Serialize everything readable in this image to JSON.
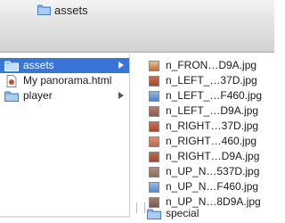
{
  "header": {
    "location_label": "assets"
  },
  "column1": {
    "items": [
      {
        "label": "assets",
        "icon": "folder-icon",
        "selected": true,
        "has_children": true
      },
      {
        "label": "My panorama.html",
        "icon": "html-file-icon",
        "selected": false,
        "has_children": false
      },
      {
        "label": "player",
        "icon": "folder-icon",
        "selected": false,
        "has_children": true
      }
    ]
  },
  "column2": {
    "items": [
      {
        "label": "n_FRON…D9A.jpg",
        "icon": "image-file-icon",
        "color": "#c46a3c"
      },
      {
        "label": "n_LEFT_…37D.jpg",
        "icon": "image-file-icon",
        "color": "#a24a2c"
      },
      {
        "label": "n_LEFT_…F460.jpg",
        "icon": "image-file-icon",
        "color": "#4a86c8"
      },
      {
        "label": "n_LEFT_…D9A.jpg",
        "icon": "image-file-icon",
        "color": "#8b5a4a"
      },
      {
        "label": "n_RIGHT…37D.jpg",
        "icon": "image-file-icon",
        "color": "#a5442e"
      },
      {
        "label": "n_RIGHT…460.jpg",
        "icon": "image-file-icon",
        "color": "#b56a4c"
      },
      {
        "label": "n_RIGHT…D9A.jpg",
        "icon": "image-file-icon",
        "color": "#9a4a34"
      },
      {
        "label": "n_UP_N…537D.jpg",
        "icon": "image-file-icon",
        "color": "#8a6a5a"
      },
      {
        "label": "n_UP_N…F460.jpg",
        "icon": "image-file-icon",
        "color": "#5a8ac8"
      },
      {
        "label": "n_UP_N…8D9A.jpg",
        "icon": "image-file-icon",
        "color": "#7a5a4a"
      },
      {
        "label": "special",
        "icon": "folder-icon",
        "color": "#6aa0d8"
      }
    ]
  },
  "colors": {
    "selection": "#3875d7",
    "folder_blue": "#6aa0d8"
  }
}
